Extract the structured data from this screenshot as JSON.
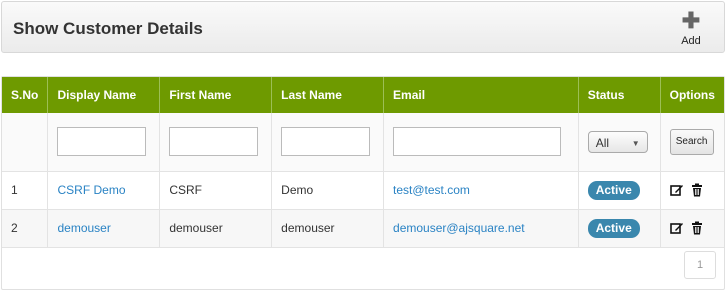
{
  "header": {
    "title": "Show Customer Details",
    "add_label": "Add"
  },
  "columns": [
    "S.No",
    "Display Name",
    "First Name",
    "Last Name",
    "Email",
    "Status",
    "Options"
  ],
  "filters": {
    "status_selected": "All",
    "search_label": "Search"
  },
  "rows": [
    {
      "sno": "1",
      "display_name": "CSRF Demo",
      "first_name": "CSRF",
      "last_name": "Demo",
      "email": "test@test.com",
      "status": "Active"
    },
    {
      "sno": "2",
      "display_name": "demouser",
      "first_name": "demouser",
      "last_name": "demouser",
      "email": "demouser@ajsquare.net",
      "status": "Active"
    }
  ],
  "pagination": {
    "current": "1"
  },
  "colors": {
    "header_green": "#6e9a00",
    "badge_blue": "#3a87ad",
    "link_blue": "#2a83c4"
  }
}
